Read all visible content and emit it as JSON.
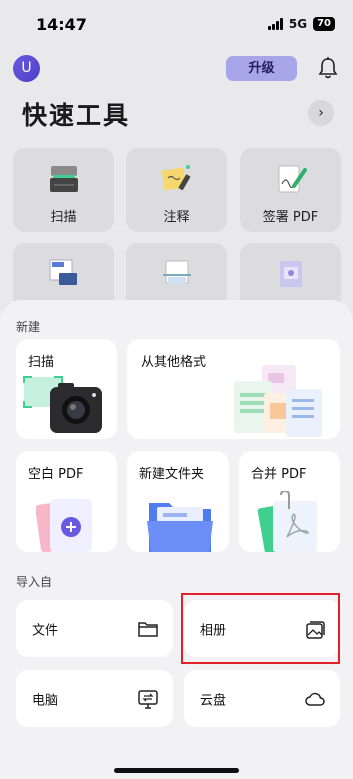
{
  "status": {
    "time": "14:47",
    "network": "5G",
    "battery": "70"
  },
  "header": {
    "avatar_letter": "U",
    "upgrade_label": "升级"
  },
  "title": "快速工具",
  "tools": [
    {
      "label": "扫描",
      "icon": "scanner-icon"
    },
    {
      "label": "注释",
      "icon": "annotate-icon"
    },
    {
      "label": "签署 PDF",
      "icon": "sign-pdf-icon"
    },
    {
      "label": "",
      "icon": "image-to-text-icon"
    },
    {
      "label": "",
      "icon": "ocr-icon"
    },
    {
      "label": "",
      "icon": "image-pdf-icon"
    }
  ],
  "new_section": {
    "title": "新建",
    "scan": "扫描",
    "from_other": "从其他格式",
    "blank_pdf": "空白 PDF",
    "new_folder": "新建文件夹",
    "merge_pdf": "合并 PDF"
  },
  "import_section": {
    "title": "导入自",
    "files": "文件",
    "album": "相册",
    "computer": "电脑",
    "cloud": "云盘"
  },
  "colors": {
    "accent": "#5b4fe0",
    "upgrade_bg": "#a7a6ea",
    "highlight": "#e0202a"
  }
}
